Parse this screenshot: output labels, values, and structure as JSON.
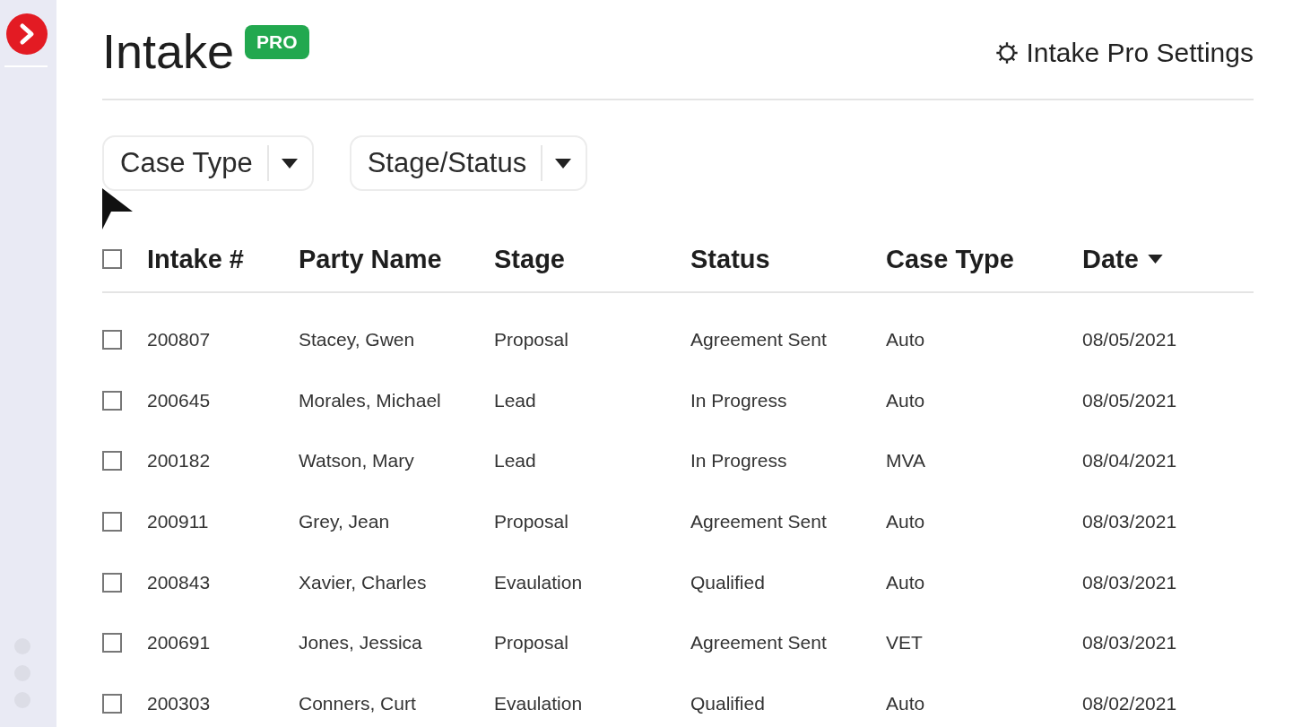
{
  "header": {
    "title": "Intake",
    "badge": "PRO",
    "settings": "Intake Pro Settings"
  },
  "filters": [
    {
      "label": "Case Type"
    },
    {
      "label": "Stage/Status"
    }
  ],
  "table": {
    "select_all": {
      "checked": false
    },
    "columns": [
      {
        "label": "Intake #",
        "sorted": false
      },
      {
        "label": "Party Name",
        "sorted": false
      },
      {
        "label": "Stage",
        "sorted": false
      },
      {
        "label": "Status",
        "sorted": false
      },
      {
        "label": "Case Type",
        "sorted": false
      },
      {
        "label": "Date",
        "sorted": true
      }
    ],
    "rows": [
      {
        "checked": false,
        "cells": [
          "200807",
          "Stacey, Gwen",
          "Proposal",
          "Agreement Sent",
          "Auto",
          "08/05/2021"
        ]
      },
      {
        "checked": false,
        "cells": [
          "200645",
          "Morales, Michael",
          "Lead",
          "In Progress",
          "Auto",
          "08/05/2021"
        ]
      },
      {
        "checked": false,
        "cells": [
          "200182",
          "Watson, Mary",
          "Lead",
          "In Progress",
          "MVA",
          "08/04/2021"
        ]
      },
      {
        "checked": false,
        "cells": [
          "200911",
          "Grey, Jean",
          "Proposal",
          "Agreement Sent",
          "Auto",
          "08/03/2021"
        ]
      },
      {
        "checked": false,
        "cells": [
          "200843",
          "Xavier, Charles",
          "Evaulation",
          "Qualified",
          "Auto",
          "08/03/2021"
        ]
      },
      {
        "checked": false,
        "cells": [
          "200691",
          "Jones, Jessica",
          "Proposal",
          "Agreement Sent",
          "VET",
          "08/03/2021"
        ]
      },
      {
        "checked": false,
        "cells": [
          "200303",
          "Conners, Curt",
          "Evaulation",
          "Qualified",
          "Auto",
          "08/02/2021"
        ]
      }
    ]
  }
}
